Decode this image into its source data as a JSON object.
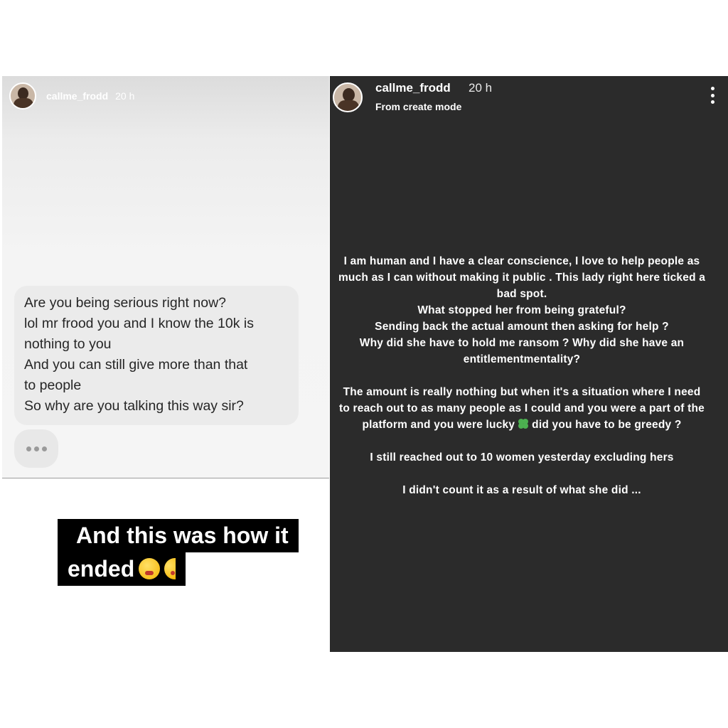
{
  "left_story": {
    "username": "callme_frodd",
    "time": "20 h",
    "message_lines": [
      "Are you being serious right now?",
      "lol mr frood you and I know the 10k is",
      "nothing to you",
      "And you can still give more than that",
      "to people",
      "So why are you talking this way sir?"
    ],
    "caption_line1": "And this was how it",
    "caption_line2": "ended",
    "caption_emoji": "face-with-steam-icon"
  },
  "right_story": {
    "username": "callme_frodd",
    "time": "20 h",
    "subtitle": "From create mode",
    "p1": "I am human and I have a clear conscience, I love to help people as much as I can without making it public . This lady right here ticked a bad spot.",
    "p1b": "What stopped her from being grateful?",
    "p1c": "Sending back the actual amount then asking for help ?",
    "p1d": "Why did she have to hold me ransom ? Why did she have an entitlementmentality?",
    "p2a": "The amount is really nothing but when it's a situation where I need to reach out to as many people as I could and you were a part of the platform and you were lucky",
    "p2b": "did you have to be greedy ?",
    "p2_emoji": "four-leaf-clover-icon",
    "p3": "I still reached out to 10 women yesterday excluding hers",
    "p4": "I didn't count it as a result of what she did ..."
  },
  "colors": {
    "right_background": "#2b2b2b",
    "bubble": "#ebebeb",
    "caption_background": "#000000"
  }
}
